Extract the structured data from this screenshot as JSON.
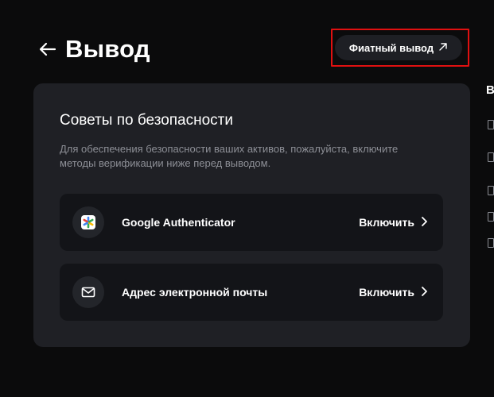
{
  "header": {
    "title": "Вывод",
    "back_icon": "arrow-left-icon"
  },
  "fiat_button": {
    "label": "Фиатный вывод",
    "icon": "arrow-up-right-icon",
    "highlight_color": "#e01010"
  },
  "security_card": {
    "title": "Советы по безопасности",
    "description": "Для обеспечения безопасности ваших активов, пожалуйста, включите методы верификации ниже перед выводом.",
    "methods": [
      {
        "label": "Google Authenticator",
        "icon": "google-authenticator-icon",
        "action_label": "Включить"
      },
      {
        "label": "Адрес электронной почты",
        "icon": "mail-icon",
        "action_label": "Включить"
      }
    ]
  },
  "right_panel": {
    "heading_fragment": "В"
  }
}
